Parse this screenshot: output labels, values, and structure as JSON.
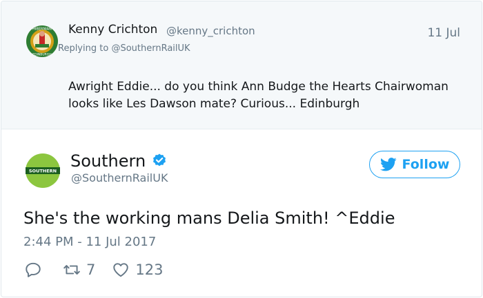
{
  "parent_tweet": {
    "name": "Kenny Crichton",
    "handle": "@kenny_crichton",
    "time": "11 Jul",
    "replying_prefix": "Replying to ",
    "replying_to": "@SouthernRailUK",
    "text": "Awright Eddie... do you think Ann Budge the Hearts Chairwoman looks like Les Dawson mate? Curious... Edinburgh",
    "avatar": {
      "icon": "hibernian-crest-avatar",
      "top_text": "HIBERNIAN",
      "bottom_text": "EDINBURGH",
      "colors": {
        "green": "#2e7d32",
        "gold": "#d4a017",
        "red": "#c62828"
      }
    }
  },
  "main_tweet": {
    "name": "Southern",
    "handle": "@SouthernRailUK",
    "verified_icon": "verified-badge-icon",
    "follow_label": "Follow",
    "text": "She's the working mans Delia Smith! ^Eddie",
    "timestamp": "2:44 PM - 11 Jul 2017",
    "avatar": {
      "icon": "southern-logo-avatar",
      "logo_text": "SOUTHERN",
      "colors": {
        "light_green": "#8cc63f",
        "dark_green": "#1b5e20"
      }
    },
    "stats": {
      "reply_count": "",
      "retweet_count": "7",
      "like_count": "123"
    }
  },
  "colors": {
    "accent": "#1da1f2",
    "muted": "#657786",
    "text": "#14171a",
    "parent_bg": "#f5f8fa"
  }
}
